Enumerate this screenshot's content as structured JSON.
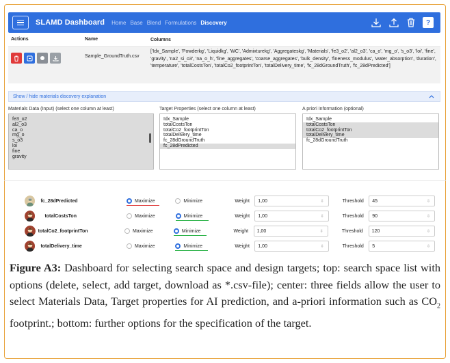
{
  "navbar": {
    "brand": "SLAMD Dashboard",
    "links": [
      "Home",
      "Base",
      "Blend",
      "Formulations",
      "Discovery"
    ],
    "active_link": "Discovery",
    "help_label": "?",
    "icons": [
      "hamburger-menu-icon",
      "download-icon",
      "upload-icon",
      "trash-icon",
      "help-icon"
    ],
    "accent_color": "#2f6fde"
  },
  "table": {
    "headers": [
      "Actions",
      "Name",
      "Columns"
    ],
    "rows": [
      {
        "name": "Sample_GroundTruth.csv",
        "columns": "['Idx_Sample', 'Powderkg', 'Liquidkg', 'WC', 'Admixturekg', 'Aggregateskg', 'Materials', 'fe3_o2', 'al2_o3', 'ca_o', 'mg_o', 's_o3', 'loi', 'fine', 'gravity', 'na2_si_o3', 'na_o_h', 'fine_aggregates', 'coarse_aggregates', 'bulk_density', 'fineness_modulus', 'water_absorption', 'duration', 'temperature', 'totalCostsTon', 'totalCo2_footprintTon', 'totalDelivery_time', 'fc_28dGroundTruth', 'fc_28dPredicted']",
        "actions": [
          "delete",
          "select",
          "add target",
          "download"
        ]
      }
    ]
  },
  "toggle": {
    "label": "Show / hide materials discovery explanation"
  },
  "materials": {
    "label": "Materials Data (Input) (select one column at least)",
    "options": [
      "fe3_o2",
      "al2_o3",
      "ca_o",
      "mg_o",
      "s_o3",
      "loi",
      "fine",
      "gravity"
    ]
  },
  "targets": {
    "label": "Target Properties (select one column at least)",
    "options": [
      "Idx_Sample",
      "totalCostsTon",
      "totalCo2_footprintTon",
      "totalDelivery_time",
      "fc_28dGroundTruth",
      "fc_28dPredicted"
    ],
    "selected": [
      5
    ]
  },
  "apriori": {
    "label": "A priori Information (optional)",
    "options": [
      "Idx_Sample",
      "totalCostsTon",
      "totalCo2_footprintTon",
      "totalDelivery_time",
      "fc_28dGroundTruth"
    ],
    "selected": [
      1,
      2,
      3
    ]
  },
  "target_rows": [
    {
      "name": "fc_28dPredicted",
      "mode": "Maximize",
      "weight": "1,00",
      "threshold": "45",
      "underline_color": "#e03a3a"
    },
    {
      "name": "totalCostsTon",
      "mode": "Minimize",
      "weight": "1,00",
      "threshold": "90",
      "underline_color": "#2db34a"
    },
    {
      "name": "totalCo2_footprintTon",
      "mode": "Minimize",
      "weight": "1,00",
      "threshold": "120",
      "underline_color": "#2db34a"
    },
    {
      "name": "totalDelivery_time",
      "mode": "Minimize",
      "weight": "1,00",
      "threshold": "5",
      "underline_color": "#2db34a"
    }
  ],
  "labels": {
    "maximize": "Maximize",
    "minimize": "Minimize",
    "weight": "Weight",
    "threshold": "Threshold"
  },
  "caption": {
    "figure": "Figure A3:",
    "text_before_sub": " Dashboard for selecting search space and design targets; top: search space list with options (delete, select, add target, download as *.csv-file); center: three fields allow the user to select Materials Data, Target properties for AI prediction, and a-priori information such as CO",
    "sub": "2",
    "text_after_sub": " footprint.; bottom: further options for the specification of the target."
  }
}
